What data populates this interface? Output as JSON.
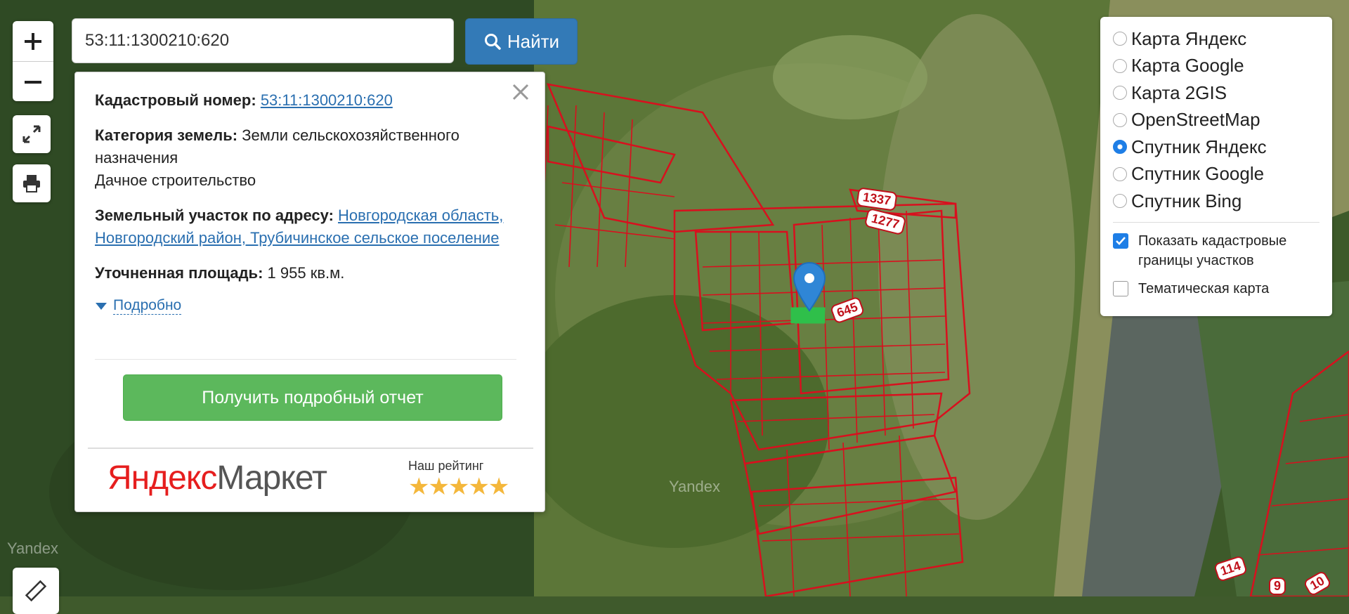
{
  "search": {
    "value": "53:11:1300210:620",
    "button_label": "Найти"
  },
  "popup": {
    "cadastral_label": "Кадастровый номер:",
    "cadastral_value": "53:11:1300210:620",
    "category_label": "Категория земель:",
    "category_value": "Земли сельскохозяйственного назначения",
    "use_value": "Дачное строительство",
    "address_label": "Земельный участок по адресу:",
    "address_value": "Новгородская область, Новгородский район, Трубичинское сельское поселение",
    "area_label": "Уточненная площадь:",
    "area_value": "1 955 кв.м.",
    "more_label": "Подробно",
    "report_button": "Получить подробный отчет",
    "market_logo_yandex": "Яндекс",
    "market_logo_market": "Маркет",
    "rating_label": "Наш рейтинг",
    "rating_stars": 5
  },
  "layers": {
    "options": [
      {
        "label": "Карта Яндекс",
        "selected": false
      },
      {
        "label": "Карта Google",
        "selected": false
      },
      {
        "label": "Карта 2GIS",
        "selected": false
      },
      {
        "label": "OpenStreetMap",
        "selected": false
      },
      {
        "label": "Спутник Яндекс",
        "selected": true
      },
      {
        "label": "Спутник Google",
        "selected": false
      },
      {
        "label": "Спутник Bing",
        "selected": false
      }
    ],
    "show_borders_label": "Показать кадастровые границы участков",
    "show_borders_checked": true,
    "thematic_label": "Тематическая карта",
    "thematic_checked": false
  },
  "map": {
    "plot_labels": [
      "1337",
      "1277",
      "645",
      "114",
      "9",
      "10"
    ],
    "watermark": "Yandex",
    "colors": {
      "border": "#d8101e",
      "selected_plot": "#2fbf4a",
      "marker": "#2f86d6"
    }
  }
}
